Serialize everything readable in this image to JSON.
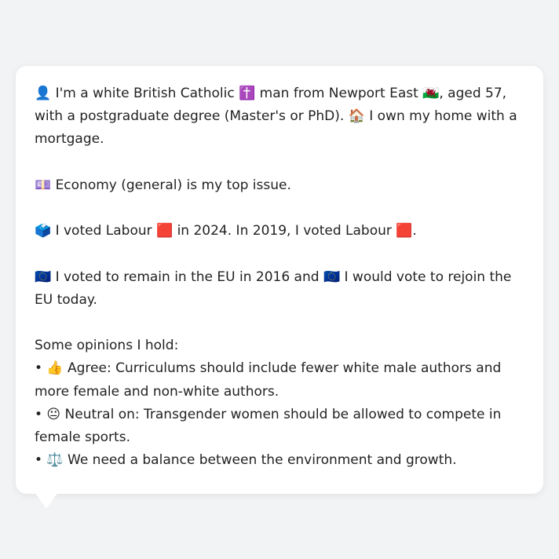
{
  "intro_text": "👤 I'm a white British Catholic ✝️ man from Newport East 🏴󠁧󠁢󠁷󠁬󠁳󠁿, aged 57, with a postgraduate degree (Master's or PhD). 🏠 I own my home with a mortgage.",
  "top_issue_text": "💷 Economy (general) is my top issue.",
  "vote_text": "🗳️ I voted Labour 🟥 in 2024. In 2019, I voted Labour 🟥.",
  "eu_text": "🇪🇺 I voted to remain in the EU in 2016 and 🇪🇺 I would vote to rejoin the EU today.",
  "opinions_heading": "Some opinions I hold:",
  "opinions": [
    "• 👍 Agree: Curriculums should include fewer white male authors and more female and non-white authors.",
    "• 😐 Neutral on: Transgender women should be allowed to compete in female sports.",
    "• ⚖️ We need a balance between the environment and growth."
  ],
  "colors": {
    "page_background": "#f2f3f5",
    "bubble_background": "#ffffff",
    "text": "#222222"
  }
}
